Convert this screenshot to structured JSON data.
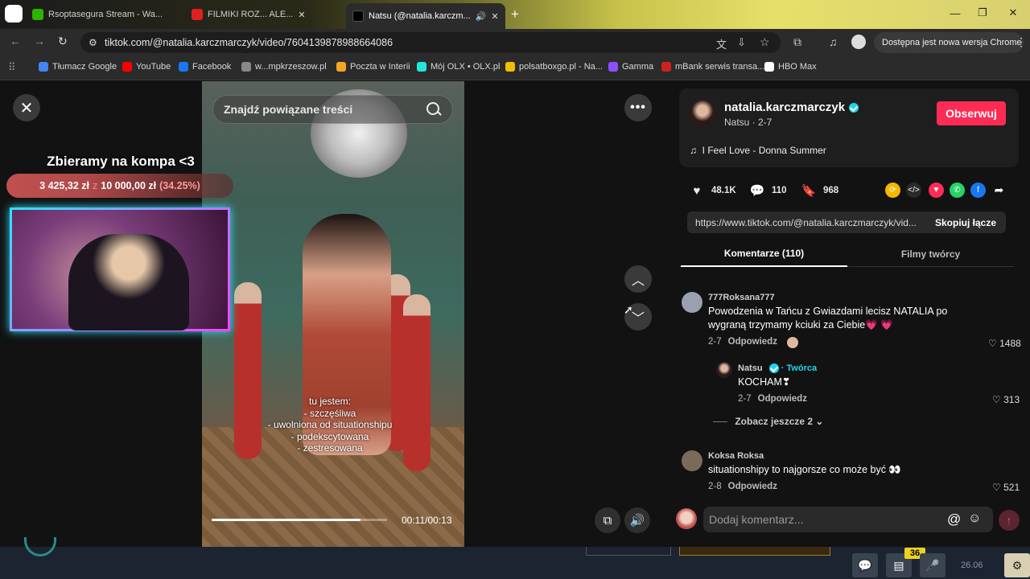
{
  "browser": {
    "tabs": [
      {
        "label": "Rsoptasegura Stream - Wa...",
        "color": "#2db300"
      },
      {
        "label": "FILMIKI ROZ... ALE...",
        "color": "#e02020"
      },
      {
        "label": "Natsu (@natalia.karczm...",
        "color": "#000000"
      }
    ],
    "url": "tiktok.com/@natalia.karczmarczyk/video/7604139878988664086",
    "update_notice": "Dostępna jest nowa wersja Chrome",
    "bookmarks": [
      {
        "label": "Tłumacz Google",
        "color": "#4285f4"
      },
      {
        "label": "YouTube",
        "color": "#ff0000"
      },
      {
        "label": "Facebook",
        "color": "#1877f2"
      },
      {
        "label": "w...mpkrzeszow.pl",
        "color": "#888888"
      },
      {
        "label": "Poczta w Interii",
        "color": "#f5a623"
      },
      {
        "label": "Mój OLX • OLX.pl",
        "color": "#23e5db"
      },
      {
        "label": "polsatboxgo.pl - Na...",
        "color": "#f0c000"
      },
      {
        "label": "Gamma",
        "color": "#8a4fff"
      },
      {
        "label": "mBank serwis transa...",
        "color": "#d02020"
      },
      {
        "label": "HBO Max",
        "color": "#ffffff"
      }
    ]
  },
  "video": {
    "search_placeholder": "Znajdź powiązane treści",
    "caption": "tu jestem:\n- szczęśliwa\n- uwolniona od situationshipu\n- podekscytowana\n- zestresowana",
    "time": "00:11/00:13",
    "progress": 0.85
  },
  "overlay": {
    "title": "Zbieramy na kompa <3",
    "raised": "3 425,32 zł",
    "of": "z",
    "goal": "10 000,00 zł",
    "percent": "(34.25%)"
  },
  "creator": {
    "username": "natalia.karczmarczyk",
    "subtitle": "Natsu · 2-7",
    "follow_label": "Obserwuj",
    "music": "I Feel Love - Donna Summer"
  },
  "stats": {
    "likes": "48.1K",
    "comments": "110",
    "saves": "968"
  },
  "share": {
    "link": "https://www.tiktok.com/@natalia.karczmarczyk/vid...",
    "copy_label": "Skopiuj łącze"
  },
  "tabs": {
    "comments": "Komentarze (110)",
    "creator_videos": "Filmy twórcy"
  },
  "comments": [
    {
      "user": "777Roksana777",
      "text": "Powodzenia w Tańcu z Gwiazdami lecisz NATALIA po wygraną trzymamy kciuki za Ciebie💗 💗",
      "date": "2-7",
      "reply": "Odpowiedz",
      "likes": "1488"
    },
    {
      "user": "Natsu",
      "creator_badge": "· Twórca",
      "text": "KOCHAM❣",
      "date": "2-7",
      "reply": "Odpowiedz",
      "likes": "313"
    },
    {
      "user": "Koksa Roksa",
      "text": "situationshipy to najgorsze co może być 👀",
      "date": "2-8",
      "reply": "Odpowiedz",
      "likes": "521"
    }
  ],
  "see_more": "Zobacz jeszcze 2",
  "comment_placeholder": "Dodaj komentarz...",
  "taskbar": {
    "badge": "36",
    "date": "26.06"
  }
}
